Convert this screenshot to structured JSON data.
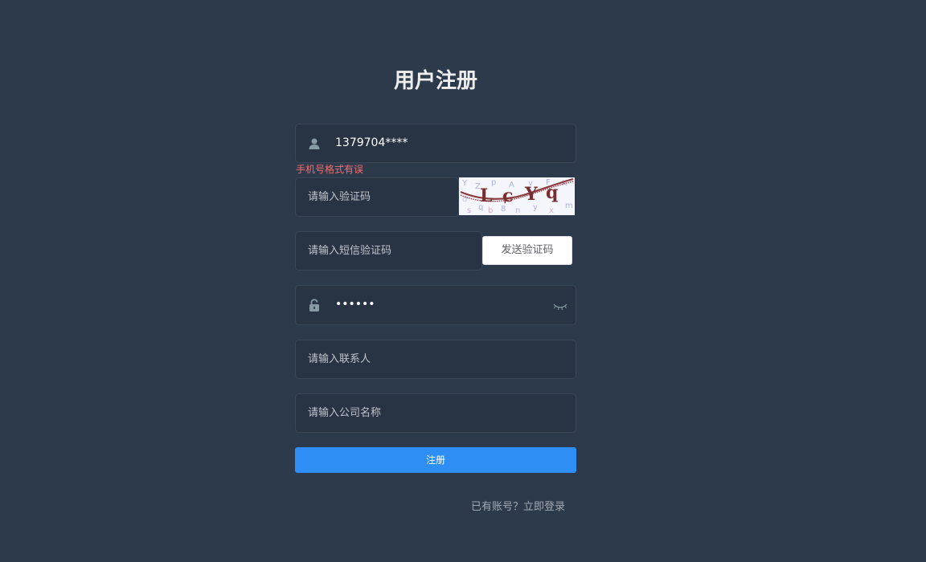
{
  "form": {
    "title": "用户注册",
    "phone": {
      "value": "1379704****",
      "icon": "user-icon"
    },
    "phone_error": "手机号格式有误",
    "captcha": {
      "placeholder": "请输入验证码"
    },
    "sms": {
      "placeholder": "请输入短信验证码",
      "button_label": "发送验证码"
    },
    "password": {
      "value": "••••••",
      "icon": "lock-icon",
      "toggle_icon": "eye-closed-icon"
    },
    "contact": {
      "placeholder": "请输入联系人"
    },
    "company": {
      "placeholder": "请输入公司名称"
    },
    "submit_label": "注册",
    "login_link": "已有账号？立即登录"
  },
  "colors": {
    "background": "#2d3a4b",
    "input_background": "#283443",
    "primary": "#2f8ef5",
    "error": "#f56c6c"
  }
}
